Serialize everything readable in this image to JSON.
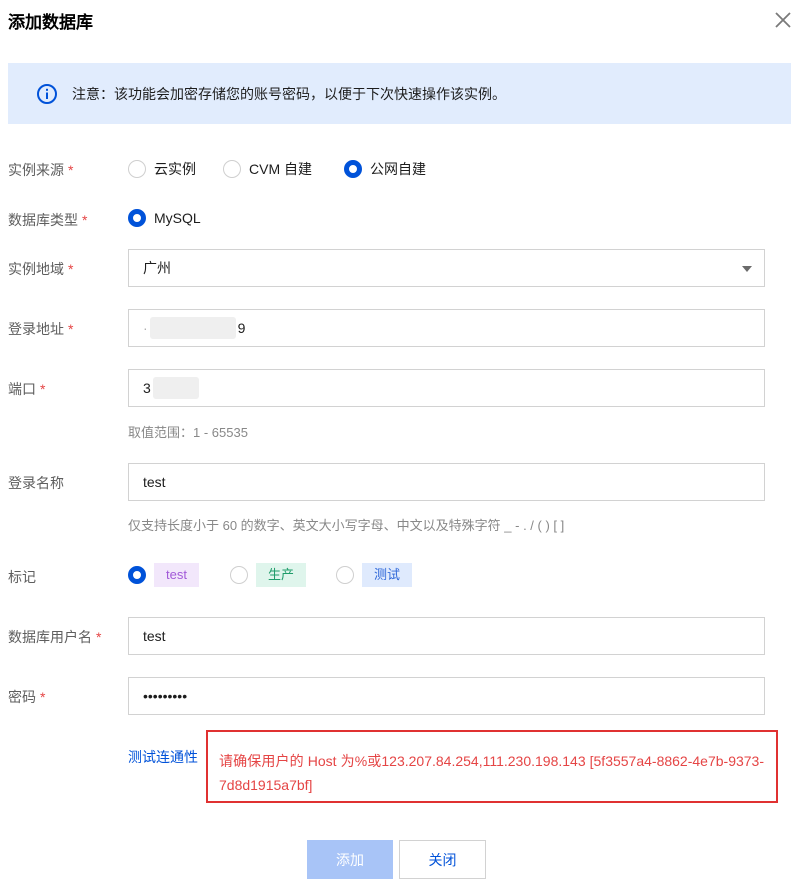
{
  "dialog": {
    "title": "添加数据库",
    "notice": "注意：该功能会加密存储您的账号密码，以便于下次快速操作该实例。"
  },
  "form": {
    "instance_source": {
      "label": "实例来源",
      "required_mark": "*",
      "options": [
        "云实例",
        "CVM 自建",
        "公网自建"
      ],
      "selected": "公网自建"
    },
    "db_type": {
      "label": "数据库类型",
      "required_mark": "*",
      "option": "MySQL"
    },
    "region": {
      "label": "实例地域",
      "required_mark": "*",
      "value": "广州"
    },
    "host": {
      "label": "登录地址",
      "required_mark": "*",
      "value_prefix": "·",
      "value_suffix": "9"
    },
    "port": {
      "label": "端口",
      "required_mark": "*",
      "value_prefix": "3",
      "hint": "取值范围：1 - 65535"
    },
    "login_name": {
      "label": "登录名称",
      "value": "test",
      "hint": "仅支持长度小于 60 的数字、英文大小写字母、中文以及特殊字符 _ - . / ( ) [ ]"
    },
    "tags": {
      "label": "标记",
      "options": [
        {
          "text": "test",
          "bg": "#f2e7fb",
          "color": "#a25ad8"
        },
        {
          "text": "生产",
          "bg": "#dff5ec",
          "color": "#1f9c6a"
        },
        {
          "text": "测试",
          "bg": "#dfeafd",
          "color": "#2f68d9"
        }
      ],
      "selected": "test"
    },
    "db_user": {
      "label": "数据库用户名",
      "required_mark": "*",
      "value": "test"
    },
    "password": {
      "label": "密码",
      "required_mark": "*",
      "value": "•••••••••"
    }
  },
  "test_link": "测试连通性",
  "error_message": "请确保用户的 Host 为%或123.207.84.254,111.230.198.143 [5f3557a4-8862-4e7b-9373-7d8d1915a7bf]",
  "buttons": {
    "add": "添加",
    "close": "关闭"
  },
  "colors": {
    "primary": "#0052d9",
    "required": "#e54545",
    "error_border": "#e03131",
    "notice_bg": "#e1ecfd",
    "add_disabled": "#a8c4f7"
  }
}
